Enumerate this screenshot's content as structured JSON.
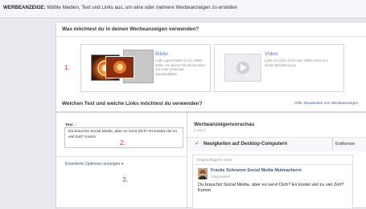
{
  "topbar": {
    "label": "WERBEANZEIGE:",
    "text": "Wähle Medien, Text und Links aus, um eine oder mehrere Werbeanzeigen zu erstellen"
  },
  "media_section": {
    "title": "Was möchtest du in deinen Werbeanzeigen verwenden?",
    "marker": "1.",
    "options": [
      {
        "title": "Bilder",
        "description": "Lade eigene Bilder hoch, wähle Bilder von deiner Facebook-Seite aus oder verwende Standardbilder"
      },
      {
        "title": "Video",
        "description": "Lade ein Video hoch oder wähle eines aus deiner Bibliothek aus"
      }
    ]
  },
  "text_section": {
    "title": "Welchen Text und welche Links möchtest du verwenden?",
    "help_link": "Hilfe: Bearbeiten von Werbeanzeigen",
    "text_label": "Text",
    "text_value": "Du brauchst Social Media, aber es nervt Dich? Es kostet viel zu viel Zeit? Komm",
    "marker2": "2.",
    "advanced_link": "Erweiterte Optionen anzeigen",
    "marker3": "3."
  },
  "preview": {
    "title": "Werbeanzeigenvorschau",
    "count": "1 von 1",
    "placement": "Neuigkeiten auf Desktop-Computern",
    "remove": "Entfernen",
    "suggested": "Vorgeschlagene Seite",
    "page_name": "Frauke Schramm Social Media Mutmacherin",
    "sponsored": "Gesponsert",
    "ad_text": "Du brauchst Social Media, aber es nervt Dich? Es kostet viel zu viel Zeit? Komm"
  },
  "colors": {
    "accent": "#3b5998",
    "marker": "#dd3333",
    "background": "#e9eaed"
  }
}
